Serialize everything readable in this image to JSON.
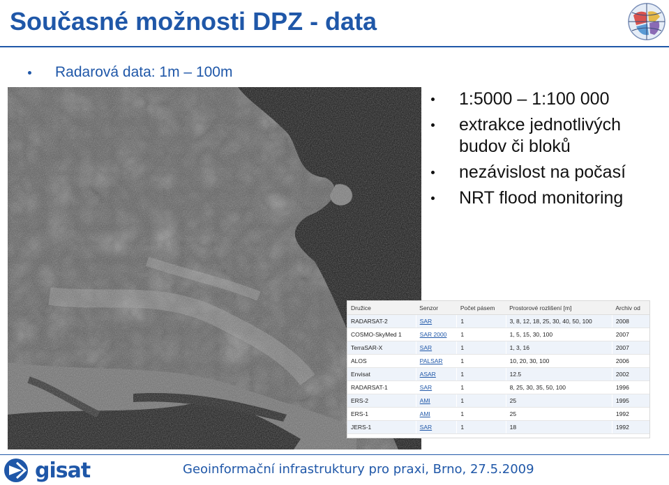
{
  "slide": {
    "title": "Současné možnosti DPZ - data",
    "subtitle": "Radarová data: 1m – 100m",
    "bullets": [
      "1:5000 – 1:100 000",
      "extrakce jednotlivých budov či bloků",
      "nezávislost na počasí",
      "NRT flood monitoring"
    ],
    "footer": "Geoinformační infrastruktury pro praxi, Brno, 27.5.2009",
    "logo_text": "gisat"
  },
  "table": {
    "headers": [
      "Družice",
      "Senzor",
      "Počet pásem",
      "Prostorové rozlišení [m]",
      "Archiv od"
    ],
    "rows": [
      [
        "RADARSAT-2",
        "SAR",
        "1",
        "3, 8, 12, 18, 25, 30, 40, 50, 100",
        "2008"
      ],
      [
        "COSMO-SkyMed 1",
        "SAR 2000",
        "1",
        "1, 5, 15, 30, 100",
        "2007"
      ],
      [
        "TerraSAR-X",
        "SAR",
        "1",
        "1, 3, 16",
        "2007"
      ],
      [
        "ALOS",
        "PALSAR",
        "1",
        "10, 20, 30, 100",
        "2006"
      ],
      [
        "Envisat",
        "ASAR",
        "1",
        "12.5",
        "2002"
      ],
      [
        "RADARSAT-1",
        "SAR",
        "1",
        "8, 25, 30, 35, 50, 100",
        "1996"
      ],
      [
        "ERS-2",
        "AMI",
        "1",
        "25",
        "1995"
      ],
      [
        "ERS-1",
        "AMI",
        "1",
        "25",
        "1992"
      ],
      [
        "JERS-1",
        "SAR",
        "1",
        "18",
        "1992"
      ]
    ]
  },
  "colors": {
    "accent": "#1f57a8",
    "text": "#111111"
  },
  "icons": {
    "globe": "globe-icon",
    "logo": "gisat-logo-icon"
  }
}
